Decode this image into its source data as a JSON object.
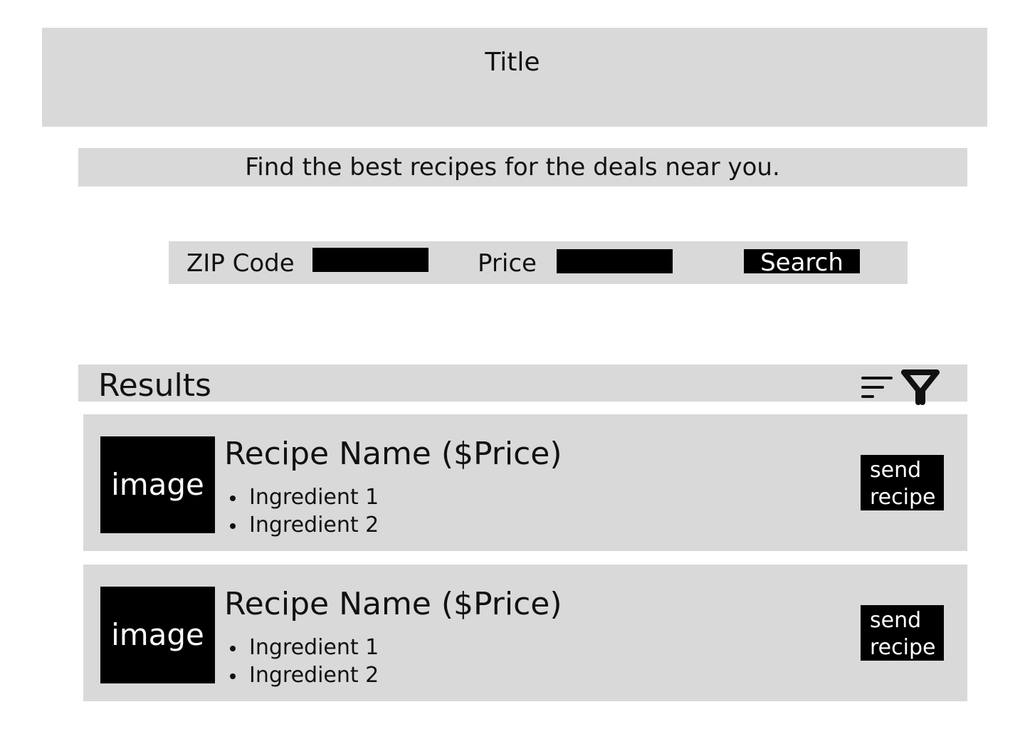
{
  "header": {
    "title": "Title"
  },
  "tagline": "Find the best recipes for the deals near you.",
  "search": {
    "zip_label": "ZIP Code",
    "zip_value": "",
    "price_label": "Price",
    "price_value": "",
    "button_label": "Search"
  },
  "results": {
    "heading": "Results",
    "sort_icon": "sort-icon",
    "filter_icon": "filter-icon",
    "items": [
      {
        "image_label": "image",
        "name": "Recipe Name ($Price)",
        "ingredients": [
          "Ingredient 1",
          "Ingredient 2"
        ],
        "button_label": "send\nrecipe"
      },
      {
        "image_label": "image",
        "name": "Recipe Name ($Price)",
        "ingredients": [
          "Ingredient 1",
          "Ingredient 2"
        ],
        "button_label": "send\nrecipe"
      }
    ]
  },
  "colors": {
    "panel": "#d9d9d9",
    "control": "#000000",
    "text": "#111111",
    "control_text": "#ffffff"
  }
}
